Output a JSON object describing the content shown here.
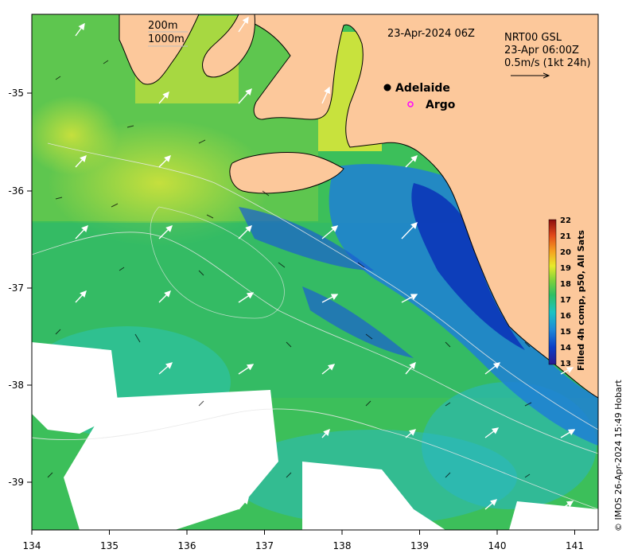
{
  "map": {
    "date_label": "23-Apr-2024 06Z",
    "product_line1": "NRT00 GSL",
    "product_line2": "23-Apr 06:00Z",
    "scale_arrow_label": "0.5m/s (1kt 24h)",
    "isobath_labels": [
      "200m",
      "1000m"
    ],
    "places": [
      {
        "name": "Adelaide",
        "lon": 138.6,
        "lat": -34.93,
        "marker": "dot"
      },
      {
        "name": "Argo",
        "lon": 138.85,
        "lat": -35.13,
        "marker": "circle"
      }
    ],
    "credit": "© IMOS 26-Apr-2024 15:49 Hobart",
    "colorbar": {
      "title": "Filled 4h comp, p50, All Sats",
      "ticks": [
        "22",
        "21",
        "20",
        "19",
        "18",
        "17",
        "16",
        "15",
        "14",
        "13"
      ]
    },
    "x_ticks": [
      "134",
      "135",
      "136",
      "137",
      "138",
      "139",
      "140",
      "141"
    ],
    "y_ticks": [
      "-35",
      "-36",
      "-37",
      "-38",
      "-39"
    ],
    "lon_range": [
      134,
      141.3
    ],
    "lat_range": [
      -39.5,
      -34.2
    ],
    "colors": {
      "land": "#fcc89b",
      "coast": "#000000",
      "arrow": "#ffffff",
      "argo_marker": "#ff00ff",
      "colormap": [
        "#2a1a8c",
        "#0b3fc8",
        "#1e88d8",
        "#1cc3c3",
        "#2fbf63",
        "#7fd13b",
        "#e8ea2a",
        "#f6a21e",
        "#e34a1a",
        "#8c0d0d"
      ]
    }
  }
}
